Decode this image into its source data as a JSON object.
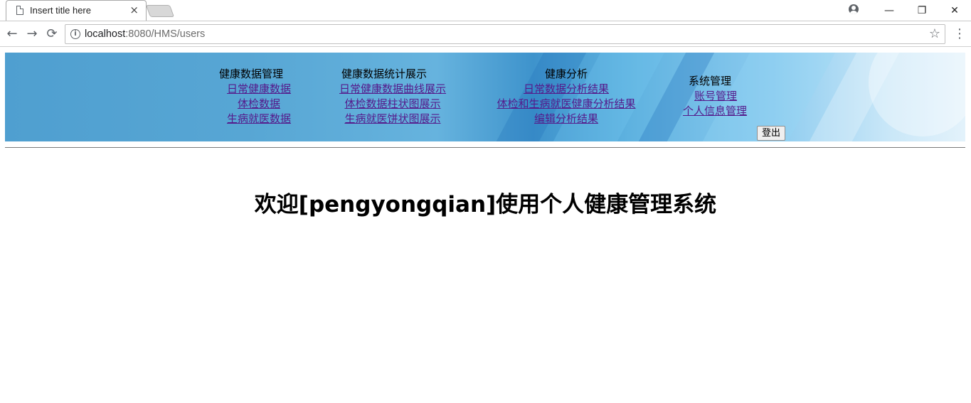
{
  "browser": {
    "tab_title": "Insert title here",
    "tab_close": "×",
    "url_host": "localhost",
    "url_rest": ":8080/HMS/users",
    "win_minimize": "—",
    "win_restore": "❐",
    "win_close": "✕",
    "nav_back": "←",
    "nav_forward": "→",
    "nav_reload": "⟳",
    "info": "i",
    "star": "☆",
    "menu": "⋮"
  },
  "nav": {
    "health_data": {
      "heading": "健康数据管理",
      "links": [
        "日常健康数据",
        "体检数据",
        "生病就医数据"
      ]
    },
    "statistics": {
      "heading": "健康数据统计展示",
      "links": [
        "日常健康数据曲线展示",
        "体检数据柱状图展示",
        "生病就医饼状图展示"
      ]
    },
    "analysis": {
      "heading": "健康分析",
      "links": [
        "日常数据分析结果",
        "体检和生病就医健康分析结果",
        "编辑分析结果"
      ]
    },
    "system": {
      "heading": "系统管理",
      "links": [
        "账号管理",
        "个人信息管理"
      ]
    }
  },
  "logout_label": "登出",
  "welcome_text": "欢迎[pengyongqian]使用个人健康管理系统"
}
